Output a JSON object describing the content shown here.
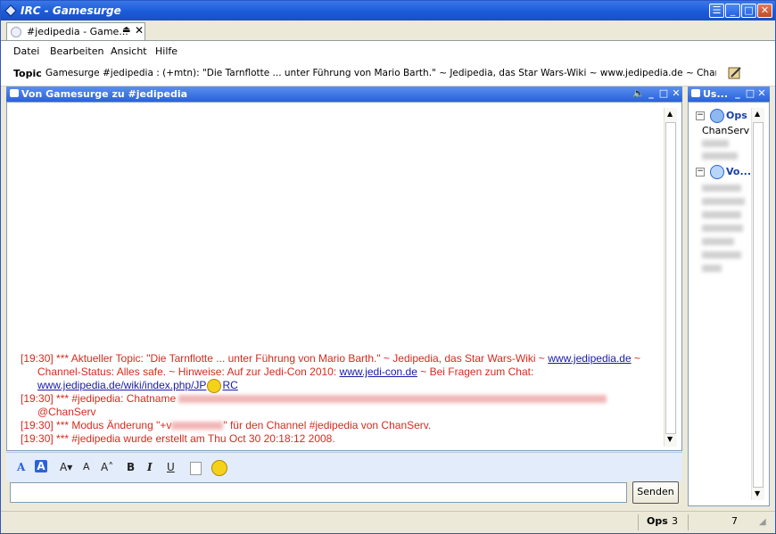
{
  "window": {
    "title": "IRC - Gamesurge"
  },
  "tab": {
    "label": "#jedipedia - Game..."
  },
  "menu": [
    "Datei",
    "Bearbeiten",
    "Ansicht",
    "Hilfe"
  ],
  "topic": {
    "label": "Topic",
    "text": "Gamesurge #jedipedia : (+mtn): \"Die Tarnflotte ... unter Führung von Mario Barth.\" ~ Jedipedia, das Star Wars-Wiki ~ www.jedipedia.de ~ Channel-Stat..."
  },
  "chatPane": {
    "title": "Von Gamesurge zu #jedipedia"
  },
  "messages": {
    "m1_a": "[19:30] *** Aktueller Topic: \"Die Tarnflotte ... unter Führung von Mario Barth.\" ~ Jedipedia, das Star Wars-Wiki ~ ",
    "m1_link1": "www.jedipedia.de",
    "m1_b": " ~",
    "m1_c": "Channel-Status: Alles safe. ~ Hinweise: Auf zur Jedi-Con 2010: ",
    "m1_link2": "www.jedi-con.de",
    "m1_d": " ~ Bei Fragen zum Chat:",
    "m1_link3a": "www.jedipedia.de/wiki/index.php/JP",
    "m1_link3b": "RC",
    "m2_a": "[19:30] *** #jedipedia: Chatname",
    "m2_b": "@ChanServ",
    "m3_a": "[19:30] *** Modus Änderung \"+v",
    "m3_b": "\" für den Channel #jedipedia von ChanServ.",
    "m4": "[19:30] *** #jedipedia wurde erstellt am Thu Oct 30 20:18:12 2008."
  },
  "send": {
    "label": "Senden"
  },
  "usersPane": {
    "title": "Us...",
    "groups": [
      {
        "name": "Ops",
        "members": [
          "ChanServ"
        ]
      },
      {
        "name": "Vo..."
      }
    ]
  },
  "status": {
    "ops_label": "Ops",
    "ops_count": "3",
    "total": "7"
  },
  "colors": {
    "accent": "#2a62d8",
    "chat_text": "#d42b1f",
    "link": "#1a1aa6"
  }
}
